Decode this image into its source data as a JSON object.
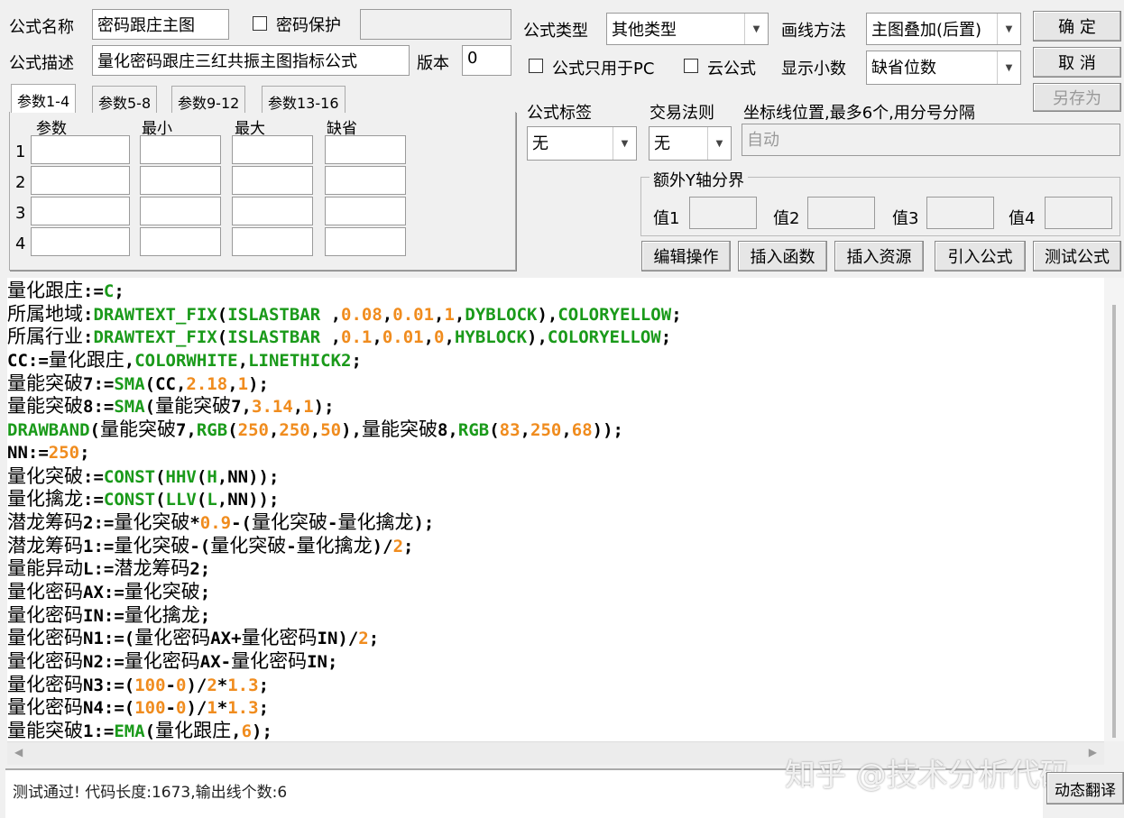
{
  "header": {
    "name_label": "公式名称",
    "name_value": "密码跟庄主图",
    "password_label": "密码保护",
    "desc_label": "公式描述",
    "desc_value": "量化密码跟庄三红共振主图指标公式",
    "version_label": "版本",
    "version_value": "0",
    "type_label": "公式类型",
    "type_value": "其他类型",
    "draw_label": "画线方法",
    "draw_value": "主图叠加(后置)",
    "pc_only_label": "公式只用于PC",
    "cloud_label": "云公式",
    "decimals_label": "显示小数",
    "decimals_value": "缺省位数",
    "ok": "确 定",
    "cancel": "取 消",
    "save_as": "另存为"
  },
  "tabs": [
    "参数1-4",
    "参数5-8",
    "参数9-12",
    "参数13-16"
  ],
  "params": {
    "headers": [
      "参数",
      "最小",
      "最大",
      "缺省"
    ],
    "rows": [
      "1",
      "2",
      "3",
      "4"
    ]
  },
  "right": {
    "tag_label": "公式标签",
    "tag_value": "无",
    "rule_label": "交易法则",
    "rule_value": "无",
    "coord_label": "坐标线位置,最多6个,用分号分隔",
    "coord_placeholder": "自动",
    "yaxis_label": "额外Y轴分界",
    "values": [
      "值1",
      "值2",
      "值3",
      "值4"
    ]
  },
  "actions": [
    "编辑操作",
    "插入函数",
    "插入资源",
    "引入公式",
    "测试公式"
  ],
  "code": [
    [
      [
        "t",
        "量化跟庄"
      ],
      [
        "o",
        ":="
      ],
      [
        "f",
        "C"
      ],
      [
        "o",
        ";"
      ]
    ],
    [
      [
        "t",
        "所属地域"
      ],
      [
        "o",
        ":"
      ],
      [
        "f",
        "DRAWTEXT_FIX"
      ],
      [
        "o",
        "("
      ],
      [
        "f",
        "ISLASTBAR"
      ],
      [
        "o",
        " ,"
      ],
      [
        "n",
        "0.08"
      ],
      [
        "o",
        ","
      ],
      [
        "n",
        "0.01"
      ],
      [
        "o",
        ","
      ],
      [
        "n",
        "1"
      ],
      [
        "o",
        ","
      ],
      [
        "f",
        "DYBLOCK"
      ],
      [
        "o",
        "),"
      ],
      [
        "f",
        "COLORYELLOW"
      ],
      [
        "o",
        ";"
      ]
    ],
    [
      [
        "t",
        "所属行业"
      ],
      [
        "o",
        ":"
      ],
      [
        "f",
        "DRAWTEXT_FIX"
      ],
      [
        "o",
        "("
      ],
      [
        "f",
        "ISLASTBAR"
      ],
      [
        "o",
        " ,"
      ],
      [
        "n",
        "0.1"
      ],
      [
        "o",
        ","
      ],
      [
        "n",
        "0.01"
      ],
      [
        "o",
        ","
      ],
      [
        "n",
        "0"
      ],
      [
        "o",
        ","
      ],
      [
        "f",
        "HYBLOCK"
      ],
      [
        "o",
        "),"
      ],
      [
        "f",
        "COLORYELLOW"
      ],
      [
        "o",
        ";"
      ]
    ],
    [
      [
        "o",
        "CC:="
      ],
      [
        "t",
        "量化跟庄"
      ],
      [
        "o",
        ","
      ],
      [
        "f",
        "COLORWHITE"
      ],
      [
        "o",
        ","
      ],
      [
        "f",
        "LINETHICK2"
      ],
      [
        "o",
        ";"
      ]
    ],
    [
      [
        "t",
        "量能突破"
      ],
      [
        "o",
        "7:="
      ],
      [
        "f",
        "SMA"
      ],
      [
        "o",
        "(CC,"
      ],
      [
        "n",
        "2.18"
      ],
      [
        "o",
        ","
      ],
      [
        "n",
        "1"
      ],
      [
        "o",
        ");"
      ]
    ],
    [
      [
        "t",
        "量能突破"
      ],
      [
        "o",
        "8:="
      ],
      [
        "f",
        "SMA"
      ],
      [
        "o",
        "("
      ],
      [
        "t",
        "量能突破"
      ],
      [
        "o",
        "7,"
      ],
      [
        "n",
        "3.14"
      ],
      [
        "o",
        ","
      ],
      [
        "n",
        "1"
      ],
      [
        "o",
        ");"
      ]
    ],
    [
      [
        "f",
        "DRAWBAND"
      ],
      [
        "o",
        "("
      ],
      [
        "t",
        "量能突破"
      ],
      [
        "o",
        "7,"
      ],
      [
        "f",
        "RGB"
      ],
      [
        "o",
        "("
      ],
      [
        "n",
        "250"
      ],
      [
        "o",
        ","
      ],
      [
        "n",
        "250"
      ],
      [
        "o",
        ","
      ],
      [
        "n",
        "50"
      ],
      [
        "o",
        "),"
      ],
      [
        "t",
        "量能突破"
      ],
      [
        "o",
        "8,"
      ],
      [
        "f",
        "RGB"
      ],
      [
        "o",
        "("
      ],
      [
        "n",
        "83"
      ],
      [
        "o",
        ","
      ],
      [
        "n",
        "250"
      ],
      [
        "o",
        ","
      ],
      [
        "n",
        "68"
      ],
      [
        "o",
        "));"
      ]
    ],
    [
      [
        "o",
        "NN:="
      ],
      [
        "n",
        "250"
      ],
      [
        "o",
        ";"
      ]
    ],
    [
      [
        "t",
        "量化突破"
      ],
      [
        "o",
        ":="
      ],
      [
        "f",
        "CONST"
      ],
      [
        "o",
        "("
      ],
      [
        "f",
        "HHV"
      ],
      [
        "o",
        "("
      ],
      [
        "f",
        "H"
      ],
      [
        "o",
        ",NN));"
      ]
    ],
    [
      [
        "t",
        "量化擒龙"
      ],
      [
        "o",
        ":="
      ],
      [
        "f",
        "CONST"
      ],
      [
        "o",
        "("
      ],
      [
        "f",
        "LLV"
      ],
      [
        "o",
        "("
      ],
      [
        "f",
        "L"
      ],
      [
        "o",
        ",NN));"
      ]
    ],
    [
      [
        "t",
        "潜龙筹码"
      ],
      [
        "o",
        "2:="
      ],
      [
        "t",
        "量化突破"
      ],
      [
        "o",
        "*"
      ],
      [
        "n",
        "0.9"
      ],
      [
        "o",
        "-("
      ],
      [
        "t",
        "量化突破"
      ],
      [
        "o",
        "-"
      ],
      [
        "t",
        "量化擒龙"
      ],
      [
        "o",
        ");"
      ]
    ],
    [
      [
        "t",
        "潜龙筹码"
      ],
      [
        "o",
        "1:="
      ],
      [
        "t",
        "量化突破"
      ],
      [
        "o",
        "-("
      ],
      [
        "t",
        "量化突破"
      ],
      [
        "o",
        "-"
      ],
      [
        "t",
        "量化擒龙"
      ],
      [
        "o",
        ")/"
      ],
      [
        "n",
        "2"
      ],
      [
        "o",
        ";"
      ]
    ],
    [
      [
        "t",
        "量能异动"
      ],
      [
        "o",
        "L:="
      ],
      [
        "t",
        "潜龙筹码"
      ],
      [
        "o",
        "2;"
      ]
    ],
    [
      [
        "t",
        "量化密码"
      ],
      [
        "o",
        "AX:="
      ],
      [
        "t",
        "量化突破"
      ],
      [
        "o",
        ";"
      ]
    ],
    [
      [
        "t",
        "量化密码"
      ],
      [
        "o",
        "IN:="
      ],
      [
        "t",
        "量化擒龙"
      ],
      [
        "o",
        ";"
      ]
    ],
    [
      [
        "t",
        "量化密码"
      ],
      [
        "o",
        "N1:=("
      ],
      [
        "t",
        "量化密码"
      ],
      [
        "o",
        "AX+"
      ],
      [
        "t",
        "量化密码"
      ],
      [
        "o",
        "IN)/"
      ],
      [
        "n",
        "2"
      ],
      [
        "o",
        ";"
      ]
    ],
    [
      [
        "t",
        "量化密码"
      ],
      [
        "o",
        "N2:="
      ],
      [
        "t",
        "量化密码"
      ],
      [
        "o",
        "AX-"
      ],
      [
        "t",
        "量化密码"
      ],
      [
        "o",
        "IN;"
      ]
    ],
    [
      [
        "t",
        "量化密码"
      ],
      [
        "o",
        "N3:=("
      ],
      [
        "n",
        "100"
      ],
      [
        "o",
        "-"
      ],
      [
        "n",
        "0"
      ],
      [
        "o",
        ")/"
      ],
      [
        "n",
        "2"
      ],
      [
        "o",
        "*"
      ],
      [
        "n",
        "1.3"
      ],
      [
        "o",
        ";"
      ]
    ],
    [
      [
        "t",
        "量化密码"
      ],
      [
        "o",
        "N4:=("
      ],
      [
        "n",
        "100"
      ],
      [
        "o",
        "-"
      ],
      [
        "n",
        "0"
      ],
      [
        "o",
        ")/"
      ],
      [
        "n",
        "1"
      ],
      [
        "o",
        "*"
      ],
      [
        "n",
        "1.3"
      ],
      [
        "o",
        ";"
      ]
    ],
    [
      [
        "t",
        "量能突破"
      ],
      [
        "o",
        "1:="
      ],
      [
        "f",
        "EMA"
      ],
      [
        "o",
        "("
      ],
      [
        "t",
        "量化跟庄"
      ],
      [
        "o",
        ","
      ],
      [
        "n",
        "6"
      ],
      [
        "o",
        ");"
      ]
    ]
  ],
  "status": "测试通过! 代码长度:1673,输出线个数:6",
  "translate_button": "动态翻译",
  "watermark": "知乎 @技术分析代码"
}
